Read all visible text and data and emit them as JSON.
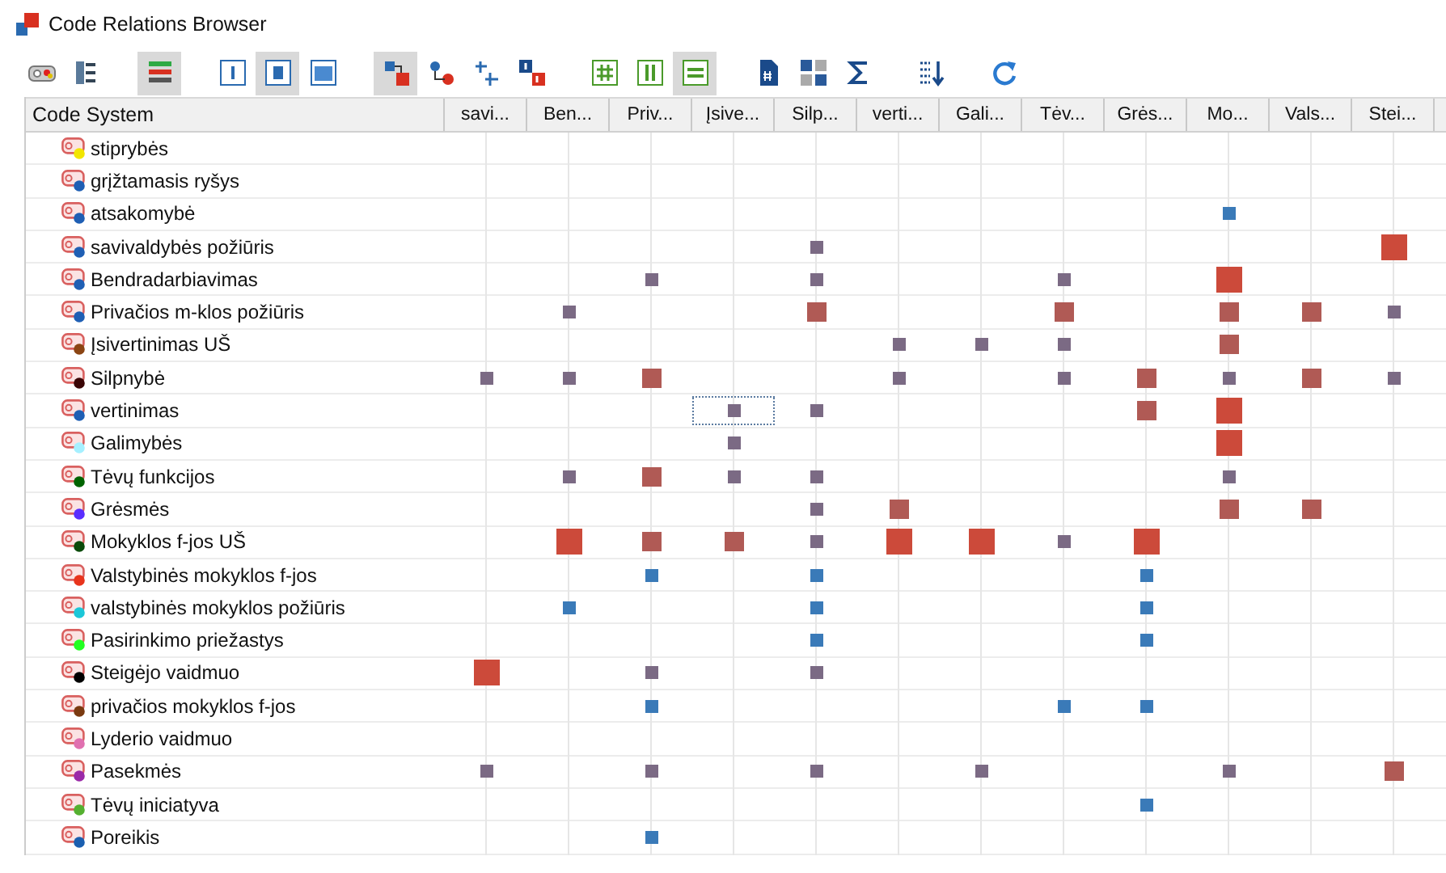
{
  "window": {
    "title": "Code Relations Browser"
  },
  "toolbar": {
    "groups": [
      [
        {
          "kind": "tag-palette",
          "selected": false
        },
        {
          "kind": "select-list",
          "selected": false
        }
      ],
      [
        {
          "kind": "bars",
          "selected": true
        }
      ],
      [
        {
          "kind": "panel-left",
          "selected": false
        },
        {
          "kind": "panel-center",
          "selected": true
        },
        {
          "kind": "panel-full",
          "selected": false
        }
      ],
      [
        {
          "kind": "squares",
          "selected": true
        },
        {
          "kind": "nodes",
          "selected": false
        },
        {
          "kind": "numbers",
          "selected": false
        },
        {
          "kind": "number-boxes",
          "selected": false
        }
      ],
      [
        {
          "kind": "hash",
          "selected": false
        },
        {
          "kind": "columns",
          "selected": false
        },
        {
          "kind": "lines",
          "selected": true
        }
      ],
      [
        {
          "kind": "document",
          "selected": false
        },
        {
          "kind": "grid-numbers",
          "selected": false
        },
        {
          "kind": "sigma",
          "selected": false
        }
      ],
      [
        {
          "kind": "sort",
          "selected": false
        }
      ],
      [
        {
          "kind": "refresh",
          "selected": false
        }
      ]
    ]
  },
  "matrix": {
    "corner": "Code System",
    "columns": [
      "savi...",
      "Ben...",
      "Priv...",
      "Įsive...",
      "Silp...",
      "verti...",
      "Gali...",
      "Tėv...",
      "Grės...",
      "Mo...",
      "Vals...",
      "Stei..."
    ],
    "rows": [
      {
        "label": "stiprybės",
        "color": "#f2e600",
        "cells": [
          null,
          null,
          null,
          null,
          null,
          null,
          null,
          null,
          null,
          null,
          null,
          null
        ]
      },
      {
        "label": "grįžtamasis ryšys",
        "color": "#1f5fb4",
        "cells": [
          null,
          null,
          null,
          null,
          null,
          null,
          null,
          null,
          null,
          null,
          null,
          null
        ]
      },
      {
        "label": "atsakomybė",
        "color": "#1f5fb4",
        "cells": [
          null,
          null,
          null,
          null,
          null,
          null,
          null,
          null,
          null,
          {
            "kind": "blue",
            "selected": false
          },
          null,
          null
        ]
      },
      {
        "label": "savivaldybės požiūris",
        "color": "#1f5fb4",
        "cells": [
          null,
          null,
          null,
          null,
          {
            "kind": "small",
            "selected": false
          },
          null,
          null,
          null,
          null,
          null,
          null,
          {
            "kind": "large",
            "selected": false
          }
        ]
      },
      {
        "label": "Bendradarbiavimas",
        "color": "#1f5fb4",
        "cells": [
          null,
          null,
          {
            "kind": "small",
            "selected": false
          },
          null,
          {
            "kind": "small",
            "selected": false
          },
          null,
          null,
          {
            "kind": "small",
            "selected": false
          },
          null,
          {
            "kind": "large",
            "selected": false
          },
          null,
          null
        ]
      },
      {
        "label": "Privačios m-klos požiūris",
        "color": "#1f5fb4",
        "cells": [
          null,
          {
            "kind": "small",
            "selected": false
          },
          null,
          null,
          {
            "kind": "medium",
            "selected": false
          },
          null,
          null,
          {
            "kind": "medium",
            "selected": false
          },
          null,
          {
            "kind": "medium",
            "selected": false
          },
          {
            "kind": "medium",
            "selected": false
          },
          {
            "kind": "small",
            "selected": false
          }
        ]
      },
      {
        "label": "Įsivertinimas UŠ",
        "color": "#8b4513",
        "cells": [
          null,
          null,
          null,
          null,
          null,
          {
            "kind": "small",
            "selected": false
          },
          {
            "kind": "small",
            "selected": false
          },
          {
            "kind": "small",
            "selected": false
          },
          null,
          {
            "kind": "medium",
            "selected": false
          },
          null,
          null
        ]
      },
      {
        "label": "Silpnybė",
        "color": "#3a0505",
        "cells": [
          {
            "kind": "small",
            "selected": false
          },
          {
            "kind": "small",
            "selected": false
          },
          {
            "kind": "medium",
            "selected": false
          },
          null,
          null,
          {
            "kind": "small",
            "selected": false
          },
          null,
          {
            "kind": "small",
            "selected": false
          },
          {
            "kind": "medium",
            "selected": false
          },
          {
            "kind": "small",
            "selected": false
          },
          {
            "kind": "medium",
            "selected": false
          },
          {
            "kind": "small",
            "selected": false
          }
        ]
      },
      {
        "label": "vertinimas",
        "color": "#1f5fb4",
        "cells": [
          null,
          null,
          null,
          {
            "kind": "small",
            "selected": true
          },
          {
            "kind": "small",
            "selected": false
          },
          null,
          null,
          null,
          {
            "kind": "medium",
            "selected": false
          },
          {
            "kind": "large",
            "selected": false
          },
          null,
          null
        ]
      },
      {
        "label": "Galimybės",
        "color": "#a6f0ff",
        "cells": [
          null,
          null,
          null,
          {
            "kind": "small",
            "selected": false
          },
          null,
          null,
          null,
          null,
          null,
          {
            "kind": "large",
            "selected": false
          },
          null,
          null
        ]
      },
      {
        "label": "Tėvų funkcijos",
        "color": "#006400",
        "cells": [
          null,
          {
            "kind": "small",
            "selected": false
          },
          {
            "kind": "medium",
            "selected": false
          },
          {
            "kind": "small",
            "selected": false
          },
          {
            "kind": "small",
            "selected": false
          },
          null,
          null,
          null,
          null,
          {
            "kind": "small",
            "selected": false
          },
          null,
          null
        ]
      },
      {
        "label": "Grėsmės",
        "color": "#5a2dff",
        "cells": [
          null,
          null,
          null,
          null,
          {
            "kind": "small",
            "selected": false
          },
          {
            "kind": "medium",
            "selected": false
          },
          null,
          null,
          null,
          {
            "kind": "medium",
            "selected": false
          },
          {
            "kind": "medium",
            "selected": false
          },
          null
        ]
      },
      {
        "label": "Mokyklos f-jos UŠ",
        "color": "#0a4a0a",
        "cells": [
          null,
          {
            "kind": "large",
            "selected": false
          },
          {
            "kind": "medium",
            "selected": false
          },
          {
            "kind": "medium",
            "selected": false
          },
          {
            "kind": "small",
            "selected": false
          },
          {
            "kind": "large",
            "selected": false
          },
          {
            "kind": "large",
            "selected": false
          },
          {
            "kind": "small",
            "selected": false
          },
          {
            "kind": "large",
            "selected": false
          },
          null,
          null,
          null
        ]
      },
      {
        "label": "Valstybinės mokyklos f-jos",
        "color": "#e8341c",
        "cells": [
          null,
          null,
          {
            "kind": "blue",
            "selected": false
          },
          null,
          {
            "kind": "blue",
            "selected": false
          },
          null,
          null,
          null,
          {
            "kind": "blue",
            "selected": false
          },
          null,
          null,
          null
        ]
      },
      {
        "label": "valstybinės mokyklos požiūris",
        "color": "#1cc7d8",
        "cells": [
          null,
          {
            "kind": "blue",
            "selected": false
          },
          null,
          null,
          {
            "kind": "blue",
            "selected": false
          },
          null,
          null,
          null,
          {
            "kind": "blue",
            "selected": false
          },
          null,
          null,
          null
        ]
      },
      {
        "label": "Pasirinkimo priežastys",
        "color": "#22ff22",
        "cells": [
          null,
          null,
          null,
          null,
          {
            "kind": "blue",
            "selected": false
          },
          null,
          null,
          null,
          {
            "kind": "blue",
            "selected": false
          },
          null,
          null,
          null
        ]
      },
      {
        "label": "Steigėjo vaidmuo",
        "color": "#000000",
        "cells": [
          {
            "kind": "large",
            "selected": false
          },
          null,
          {
            "kind": "small",
            "selected": false
          },
          null,
          {
            "kind": "small",
            "selected": false
          },
          null,
          null,
          null,
          null,
          null,
          null,
          null
        ]
      },
      {
        "label": "privačios mokyklos f-jos",
        "color": "#7a3a10",
        "cells": [
          null,
          null,
          {
            "kind": "blue",
            "selected": false
          },
          null,
          null,
          null,
          null,
          {
            "kind": "blue",
            "selected": false
          },
          {
            "kind": "blue",
            "selected": false
          },
          null,
          null,
          null
        ]
      },
      {
        "label": "Lyderio vaidmuo",
        "color": "#e070b0",
        "cells": [
          null,
          null,
          null,
          null,
          null,
          null,
          null,
          null,
          null,
          null,
          null,
          null
        ]
      },
      {
        "label": "Pasekmės",
        "color": "#9a2aa8",
        "cells": [
          {
            "kind": "small",
            "selected": false
          },
          null,
          {
            "kind": "small",
            "selected": false
          },
          null,
          {
            "kind": "small",
            "selected": false
          },
          null,
          {
            "kind": "small",
            "selected": false
          },
          null,
          null,
          {
            "kind": "small",
            "selected": false
          },
          null,
          {
            "kind": "medium",
            "selected": false
          }
        ]
      },
      {
        "label": "Tėvų iniciatyva",
        "color": "#55b030",
        "cells": [
          null,
          null,
          null,
          null,
          null,
          null,
          null,
          null,
          {
            "kind": "blue",
            "selected": false
          },
          null,
          null,
          null
        ]
      },
      {
        "label": "Poreikis",
        "color": "#1a5fb0",
        "cells": [
          null,
          null,
          {
            "kind": "blue",
            "selected": false
          },
          null,
          null,
          null,
          null,
          null,
          null,
          null,
          null,
          null
        ]
      }
    ]
  }
}
